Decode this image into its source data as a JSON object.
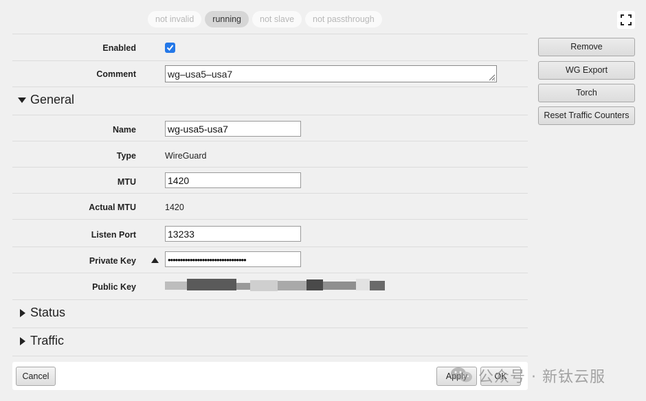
{
  "status_tabs": [
    "not invalid",
    "running",
    "not slave",
    "not passthrough"
  ],
  "fields": {
    "enabled_label": "Enabled",
    "enabled_checked": true,
    "comment_label": "Comment",
    "comment_value": "wg–usa5–usa7"
  },
  "general": {
    "title": "General",
    "name_label": "Name",
    "name_value": "wg-usa5-usa7",
    "type_label": "Type",
    "type_value": "WireGuard",
    "mtu_label": "MTU",
    "mtu_value": "1420",
    "actual_mtu_label": "Actual MTU",
    "actual_mtu_value": "1420",
    "listen_port_label": "Listen Port",
    "listen_port_value": "13233",
    "private_key_label": "Private Key",
    "private_key_value": "••••••••••••••••••••••••••••••••",
    "public_key_label": "Public Key"
  },
  "sections": {
    "status": "Status",
    "traffic": "Traffic"
  },
  "sidebar": {
    "remove": "Remove",
    "wg_export": "WG Export",
    "torch": "Torch",
    "reset": "Reset Traffic Counters"
  },
  "footer": {
    "cancel": "Cancel",
    "apply": "Apply",
    "ok": "OK"
  },
  "watermark": "公众号 · 新钛云服",
  "colors": {
    "accent": "#2478e8",
    "background": "#f0f0f0"
  }
}
